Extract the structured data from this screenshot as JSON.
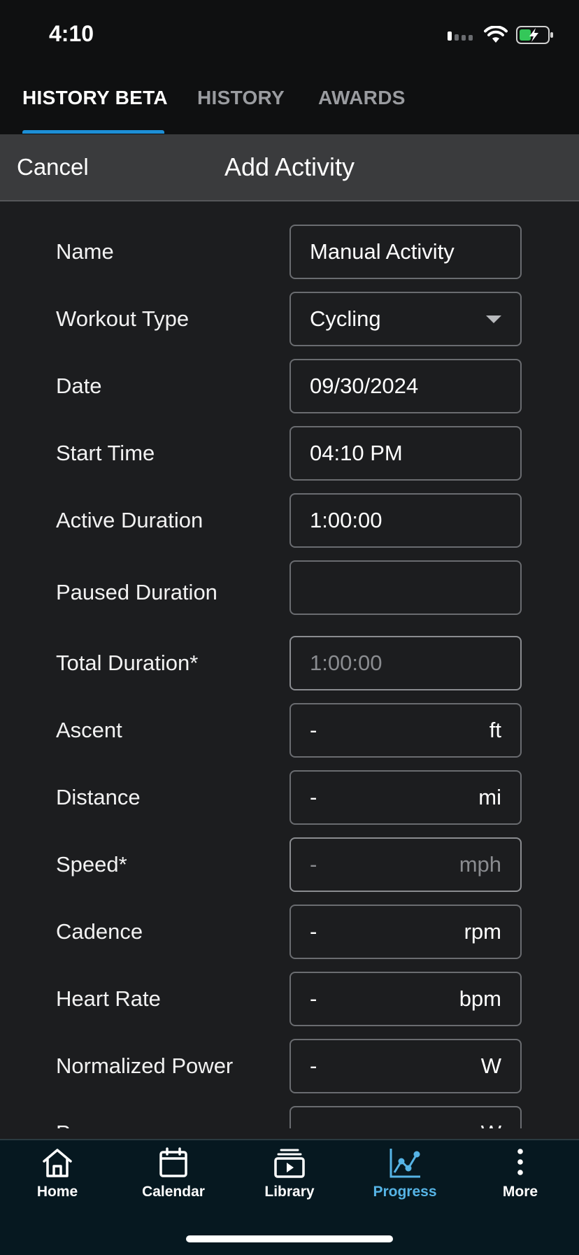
{
  "status": {
    "time": "4:10"
  },
  "tabs": [
    {
      "label": "HISTORY BETA",
      "active": true
    },
    {
      "label": "HISTORY",
      "active": false
    },
    {
      "label": "AWARDS",
      "active": false
    }
  ],
  "header": {
    "cancel_label": "Cancel",
    "title": "Add Activity"
  },
  "form": {
    "name": {
      "label": "Name",
      "value": "Manual Activity"
    },
    "workout_type": {
      "label": "Workout Type",
      "value": "Cycling"
    },
    "date": {
      "label": "Date",
      "value": "09/30/2024"
    },
    "start_time": {
      "label": "Start Time",
      "value": "04:10 PM"
    },
    "active_duration": {
      "label": "Active Duration",
      "value": "1:00:00"
    },
    "paused_duration": {
      "label": "Paused Duration",
      "value": ""
    },
    "total_duration": {
      "label": "Total Duration*",
      "value": "1:00:00"
    },
    "ascent": {
      "label": "Ascent",
      "value": "-",
      "unit": "ft"
    },
    "distance": {
      "label": "Distance",
      "value": "-",
      "unit": "mi"
    },
    "speed": {
      "label": "Speed*",
      "value": "-",
      "unit": "mph"
    },
    "cadence": {
      "label": "Cadence",
      "value": "-",
      "unit": "rpm"
    },
    "heart_rate": {
      "label": "Heart Rate",
      "value": "-",
      "unit": "bpm"
    },
    "normalized_power": {
      "label": "Normalized Power",
      "value": "-",
      "unit": "W"
    },
    "power": {
      "label": "Power",
      "value": "-",
      "unit": "W"
    }
  },
  "bottom_nav": [
    {
      "label": "Home",
      "icon": "home-icon",
      "active": false
    },
    {
      "label": "Calendar",
      "icon": "calendar-icon",
      "active": false
    },
    {
      "label": "Library",
      "icon": "library-icon",
      "active": false
    },
    {
      "label": "Progress",
      "icon": "progress-chart-icon",
      "active": true
    },
    {
      "label": "More",
      "icon": "more-vertical-icon",
      "active": false
    }
  ],
  "colors": {
    "accent": "#1d8fd6",
    "active_nav": "#56b4e6",
    "nav_background": "#061820",
    "background": "#1c1d1f"
  }
}
